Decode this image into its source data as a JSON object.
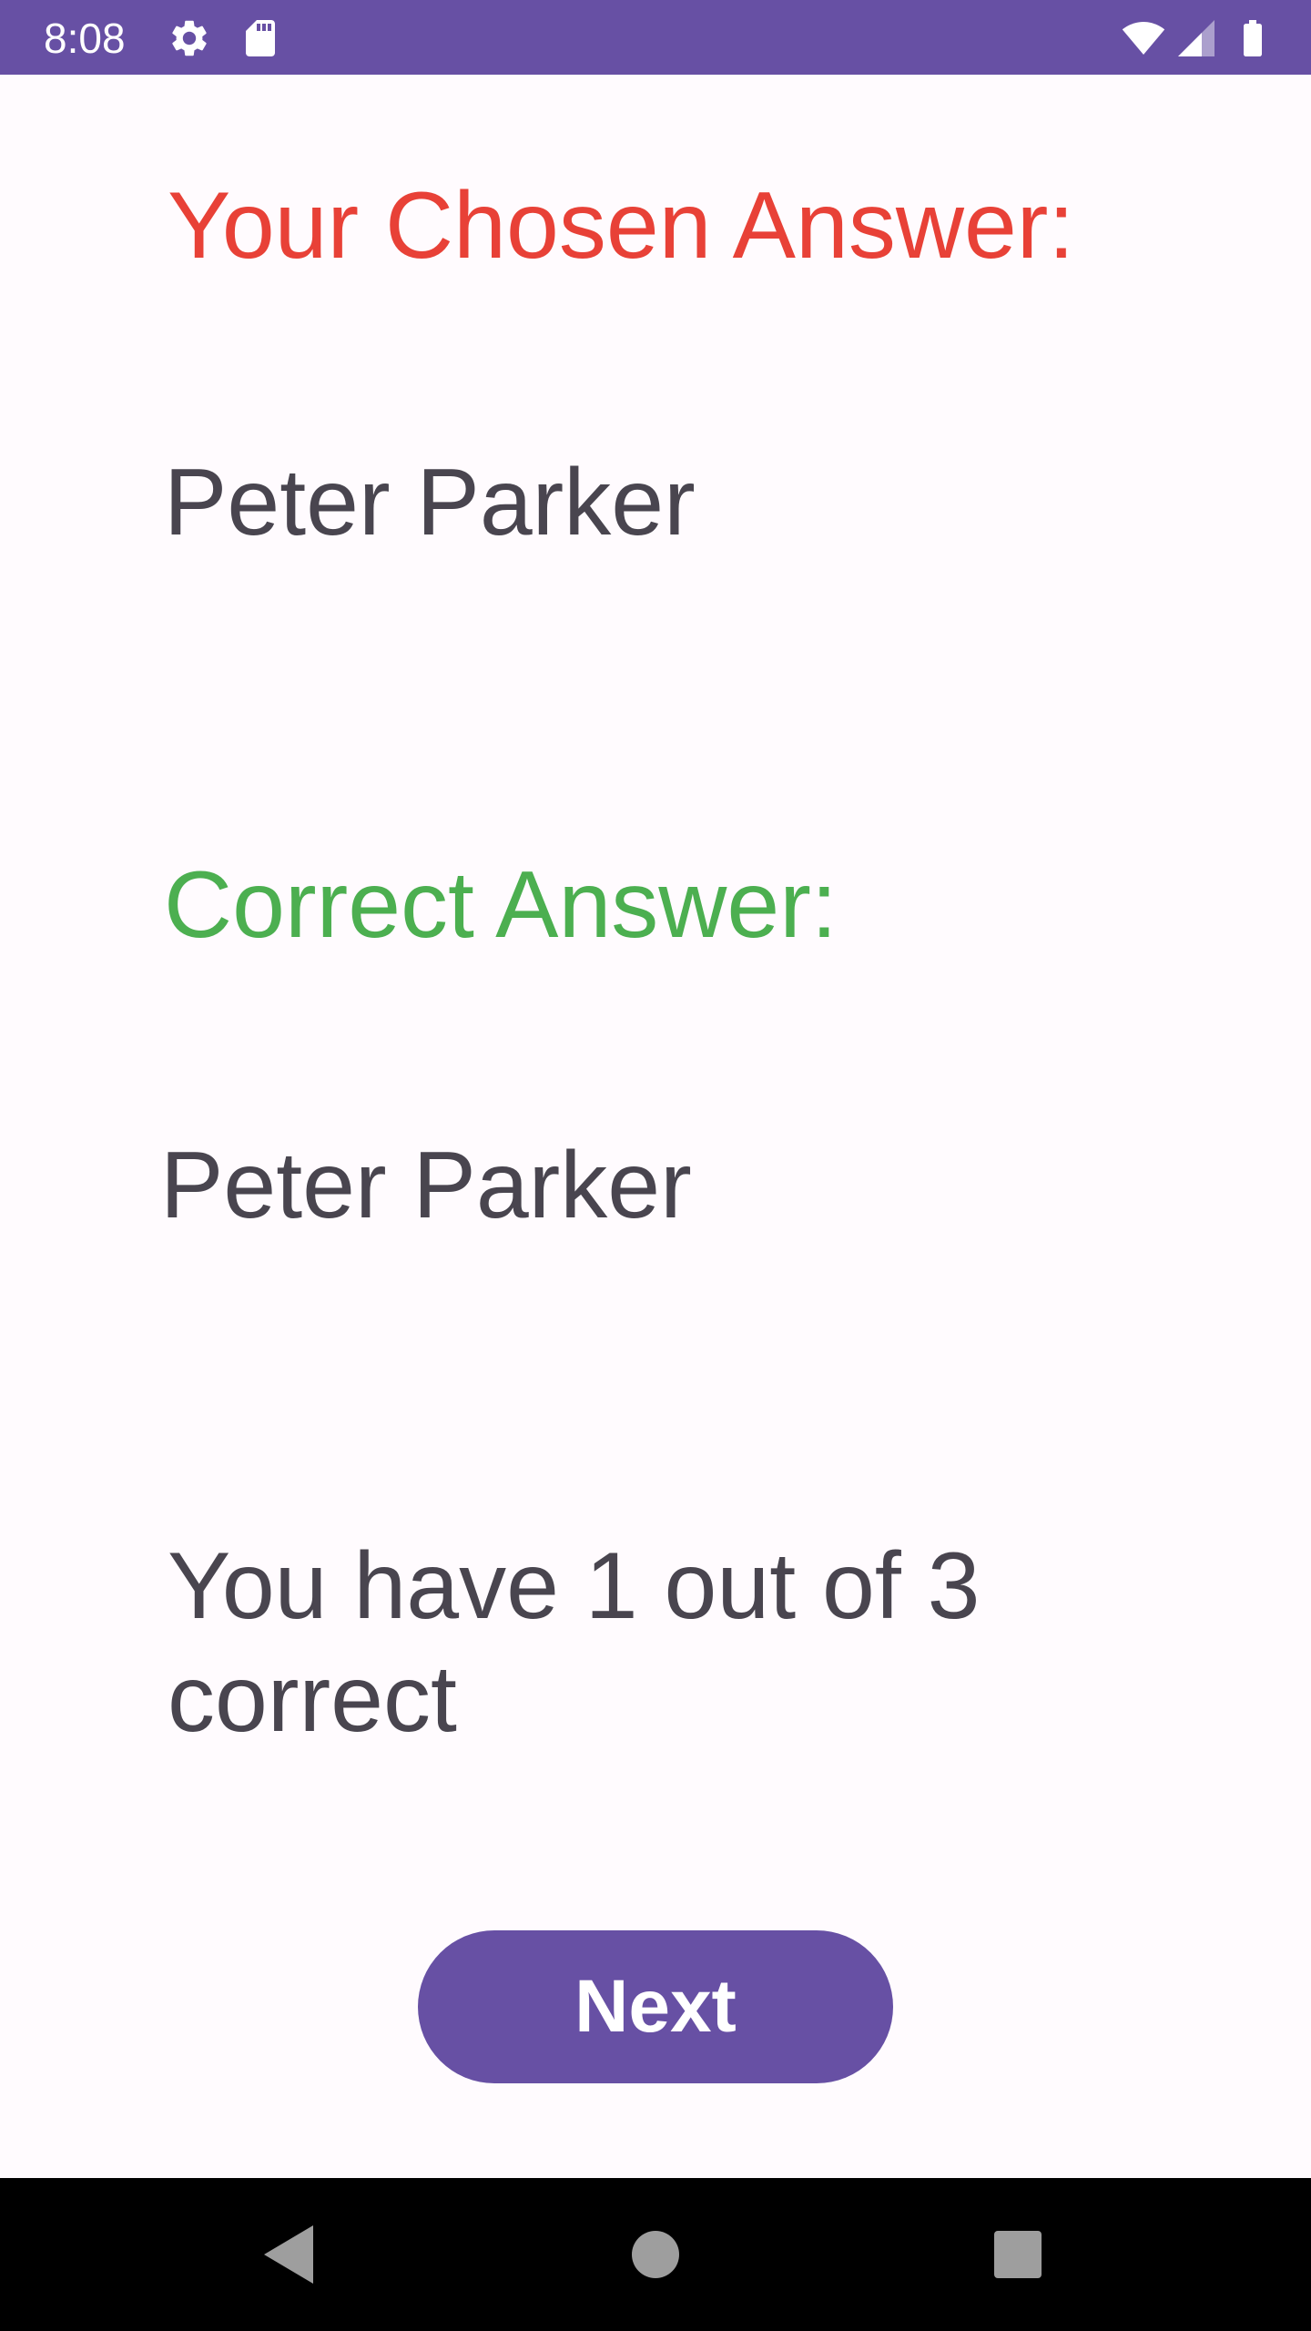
{
  "status_bar": {
    "time": "8:08",
    "background": "#6750a4",
    "left_icons": [
      "settings-icon",
      "sd-card-icon"
    ],
    "right_icons": [
      "wifi-icon",
      "cell-signal-icon",
      "battery-icon"
    ]
  },
  "quiz": {
    "chosen_heading": "Your Chosen Answer:",
    "chosen_answer": "Peter Parker",
    "correct_heading": "Correct Answer:",
    "correct_answer": "Peter Parker",
    "score_text": "You have 1 out of 3 correct",
    "next_label": "Next"
  },
  "colors": {
    "chosen_heading": "#e84137",
    "correct_heading": "#4caf50",
    "body_text": "#49454f",
    "accent": "#6750a4",
    "background": "#fffbfe"
  },
  "nav_bar": {
    "buttons": [
      "back-icon",
      "home-icon",
      "recent-apps-icon"
    ]
  }
}
